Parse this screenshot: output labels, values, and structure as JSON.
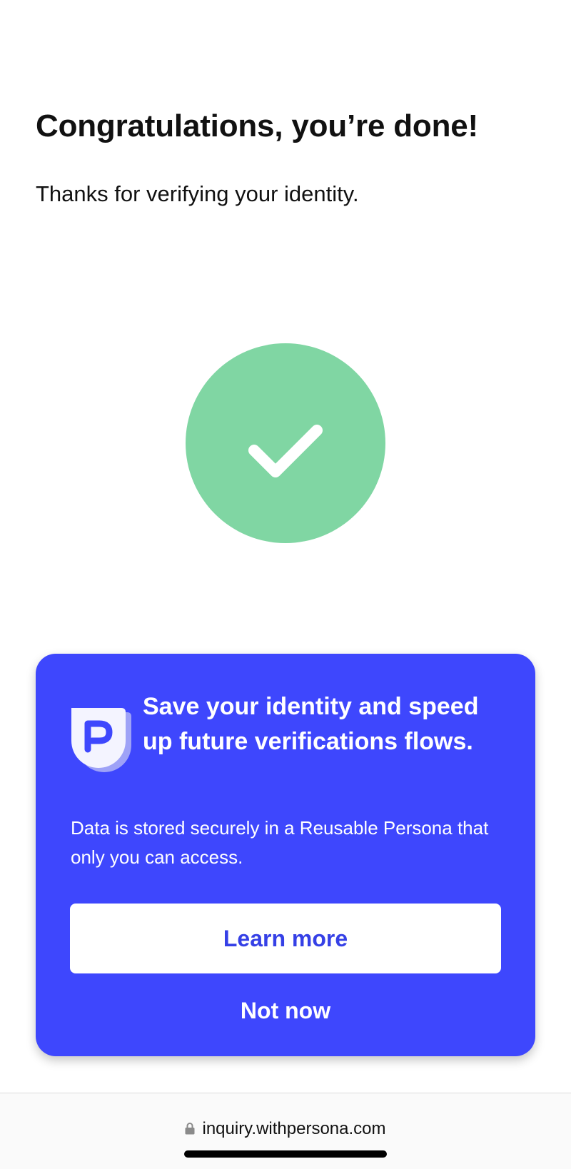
{
  "header": {
    "title": "Congratulations, you’re done!",
    "subtitle": "Thanks for verifying your identity."
  },
  "status": {
    "icon": "checkmark-icon",
    "color": "#80d6a3"
  },
  "promo": {
    "logo_icon": "persona-logo-icon",
    "heading": "Save your identity and speed up future verifications flows.",
    "body": "Data is stored securely in a Reusable Persona that only you can access.",
    "learn_more_label": "Learn more",
    "not_now_label": "Not now",
    "accent_color": "#3e47fd"
  },
  "browser": {
    "lock_icon": "lock-icon",
    "url": "inquiry.withpersona.com"
  }
}
